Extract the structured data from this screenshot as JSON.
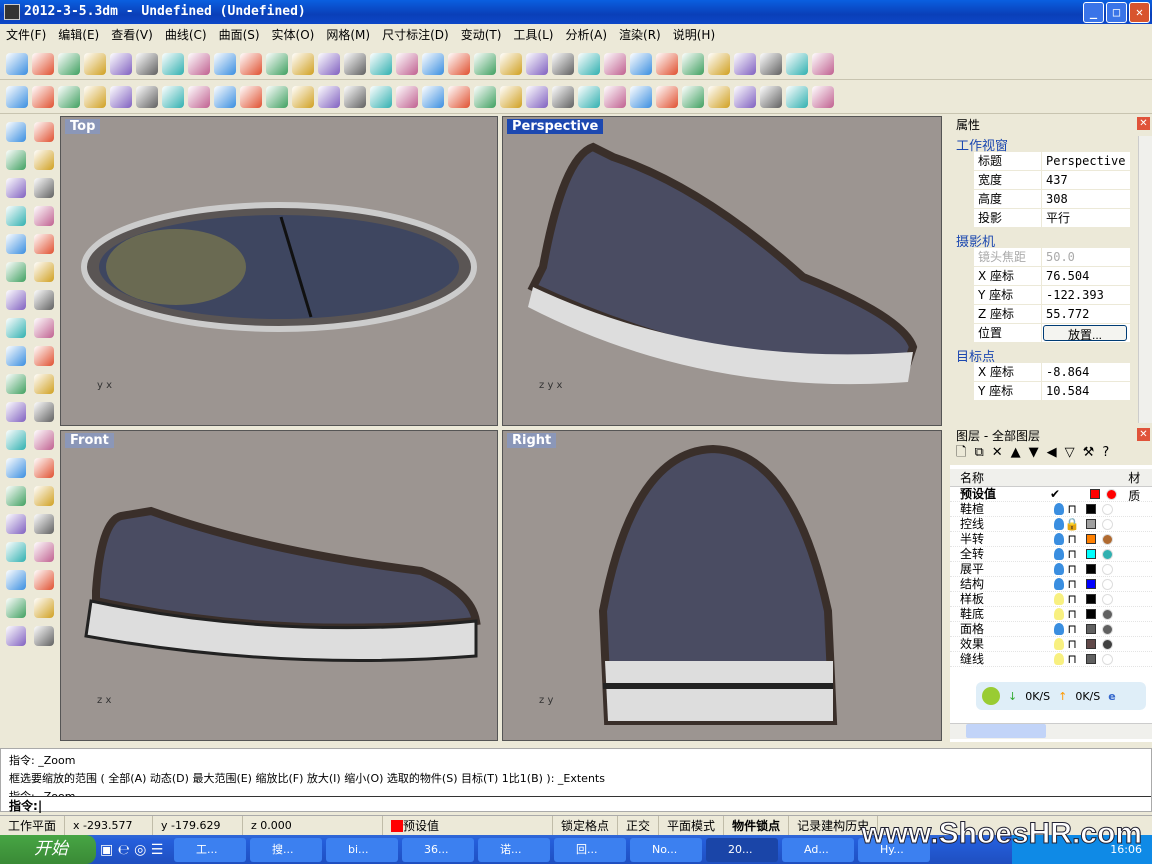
{
  "window": {
    "title": "2012-3-5.3dm - Undefined (Undefined)",
    "min": "_",
    "max": "□",
    "close": "✕"
  },
  "menu": [
    "文件(F)",
    "编辑(E)",
    "查看(V)",
    "曲线(C)",
    "曲面(S)",
    "实体(O)",
    "网格(M)",
    "尺寸标注(D)",
    "变动(T)",
    "工具(L)",
    "分析(A)",
    "渲染(R)",
    "说明(H)"
  ],
  "toolbar1_icons": [
    "new-icon",
    "open-icon",
    "save-icon",
    "print-icon",
    "import-icon",
    "cut-icon",
    "copy-icon",
    "paste-icon",
    "undo-icon",
    "pan-icon",
    "rotate-view-icon",
    "zoom-dynamic-icon",
    "zoom-window-icon",
    "zoom-extents-icon",
    "zoom-selected-icon",
    "four-viewports-icon",
    "car-icon",
    "grid-icon",
    "osnap-icon",
    "hide-icon",
    "light-icon",
    "lock-icon",
    "layer-icon",
    "color-wheel-icon",
    "wireframe-icon",
    "shaded-icon",
    "render-sphere-icon",
    "render-sphere2-icon",
    "pencil-icon",
    "settings-icon",
    "options-icon",
    "help-icon"
  ],
  "toolbar2_icons": [
    "shoe-last-1-icon",
    "shoe-last-2-icon",
    "shoe-last-3-icon",
    "shoe-sole-icon",
    "curve-offset-icon",
    "shoe-upper-icon",
    "shoe-upper-2-icon",
    "shoe-heel-icon",
    "shoe-insole-icon",
    "shoe-insole-2-icon",
    "shoe-flatten-icon",
    "shoe-eyelet-icon",
    "shoe-eye-icon",
    "shoe-eye-2-icon",
    "shoe-truck-icon",
    "shoe-side-icon",
    "shoe-side-2-icon",
    "shoe-36-icon",
    "dash-line-icon",
    "polyline-icon",
    "bell-icon",
    "arc-icon",
    "points-icon",
    "worker-icon",
    "seam-icon",
    "cylinder-icon",
    "surface-icon",
    "bend-icon",
    "blue-diamond-icon",
    "blue-diamond-2-icon",
    "flow-icon",
    "split-icon"
  ],
  "left_icons": [
    "point-icon",
    "select-icon",
    "rectangle-icon",
    "polyline-icon",
    "circle-icon",
    "circle-center-icon",
    "rectangle-2-icon",
    "polygon-icon",
    "fillet-icon",
    "polygon-2-icon",
    "surface-icon",
    "mesh-icon",
    "sphere-icon",
    "box-icon",
    "plane-icon",
    "cylinder-icon",
    "extrude-icon",
    "gear-icon",
    "trim-icon",
    "split-icon",
    "join-icon",
    "explode-icon",
    "group-icon",
    "ungroup-icon",
    "boolean-icon",
    "arc-icon",
    "move-icon",
    "mirror-icon",
    "scale-icon",
    "text-icon",
    "dim-icon",
    "copy-icon",
    "ruler-icon",
    "array-icon",
    "delete-icon",
    "solid-icon",
    "paint-icon",
    "layout-icon"
  ],
  "viewports": {
    "top": "Top",
    "perspective": "Perspective",
    "front": "Front",
    "right": "Right"
  },
  "axes": {
    "top": [
      "y",
      "x"
    ],
    "perspective": [
      "z",
      "y",
      "x"
    ],
    "front": [
      "z",
      "x"
    ],
    "right": [
      "z",
      "y"
    ]
  },
  "properties": {
    "title": "属性",
    "section_viewport": "工作视窗",
    "viewport_rows": [
      {
        "k": "标题",
        "v": "Perspective"
      },
      {
        "k": "宽度",
        "v": "437"
      },
      {
        "k": "高度",
        "v": "308"
      },
      {
        "k": "投影",
        "v": "平行"
      }
    ],
    "section_camera": "摄影机",
    "camera_rows": [
      {
        "k": "镜头焦距",
        "v": "50.0"
      },
      {
        "k": "X 座标",
        "v": "76.504"
      },
      {
        "k": "Y 座标",
        "v": "-122.393"
      },
      {
        "k": "Z 座标",
        "v": "55.772"
      }
    ],
    "position_label": "位置",
    "place_button": "放置...",
    "section_target": "目标点",
    "target_rows": [
      {
        "k": "X 座标",
        "v": "-8.864"
      },
      {
        "k": "Y 座标",
        "v": "10.584"
      }
    ]
  },
  "layers": {
    "title": "图层 - 全部图层",
    "col_name": "名称",
    "col_material": "材质",
    "items": [
      {
        "name": "预设值",
        "current": "✔",
        "color": "#ff0000",
        "mat": "#ff0000"
      },
      {
        "name": "鞋楦",
        "color": "#000000",
        "bulb": "#3a8ee0",
        "locked": false
      },
      {
        "name": "控线",
        "color": "#a0a0a0",
        "bulb": "#3a8ee0",
        "locked": true
      },
      {
        "name": "半转",
        "color": "#ff8000",
        "bulb": "#3a8ee0",
        "locked": false,
        "mat": "#b06a30"
      },
      {
        "name": "全转",
        "color": "#00ffff",
        "bulb": "#3a8ee0",
        "locked": false,
        "mat": "#30b0b0"
      },
      {
        "name": "展平",
        "color": "#000000",
        "bulb": "#3a8ee0",
        "locked": false
      },
      {
        "name": "结构",
        "color": "#0000ff",
        "bulb": "#3a8ee0",
        "locked": false
      },
      {
        "name": "样板",
        "color": "#000000",
        "bulb": "#f8f080",
        "locked": false
      },
      {
        "name": "鞋底",
        "color": "#000000",
        "bulb": "#f8f080",
        "locked": false,
        "mat": "#606060"
      },
      {
        "name": "面格",
        "color": "#606060",
        "bulb": "#3a8ee0",
        "locked": false,
        "mat": "#606060"
      },
      {
        "name": "效果",
        "color": "#604848",
        "bulb": "#f8f080",
        "locked": false,
        "mat": "#404040"
      },
      {
        "name": "缝线",
        "color": "#606060",
        "bulb": "#f8f080",
        "locked": false
      }
    ],
    "net_down": "0K/S",
    "net_up": "0K/S"
  },
  "command": {
    "line1": "指令: _Zoom",
    "line2": "框选要缩放的范围 ( 全部(A)  动态(D)  最大范围(E)  缩放比(F)  放大(I)  缩小(O)  选取的物件(S)  目标(T)  1比1(B) ): _Extents",
    "line3": "指令: _Zoom",
    "prompt": "指令:"
  },
  "status": {
    "plane": "工作平面",
    "x": "x -293.577",
    "y": "y -179.629",
    "z": "z 0.000",
    "layer": "预设值",
    "layer_color": "#ff0000",
    "snap": "锁定格点",
    "ortho": "正交",
    "planar": "平面模式",
    "osnap": "物件锁点",
    "history": "记录建构历史"
  },
  "taskbar": {
    "start": "开始",
    "items": [
      "工...",
      "搜...",
      "bi...",
      "36...",
      "诺...",
      "回...",
      "No...",
      "20...",
      "Ad...",
      "Hy..."
    ],
    "active": 7,
    "clock": "16:06"
  },
  "watermark": "www.ShoesHR.com"
}
